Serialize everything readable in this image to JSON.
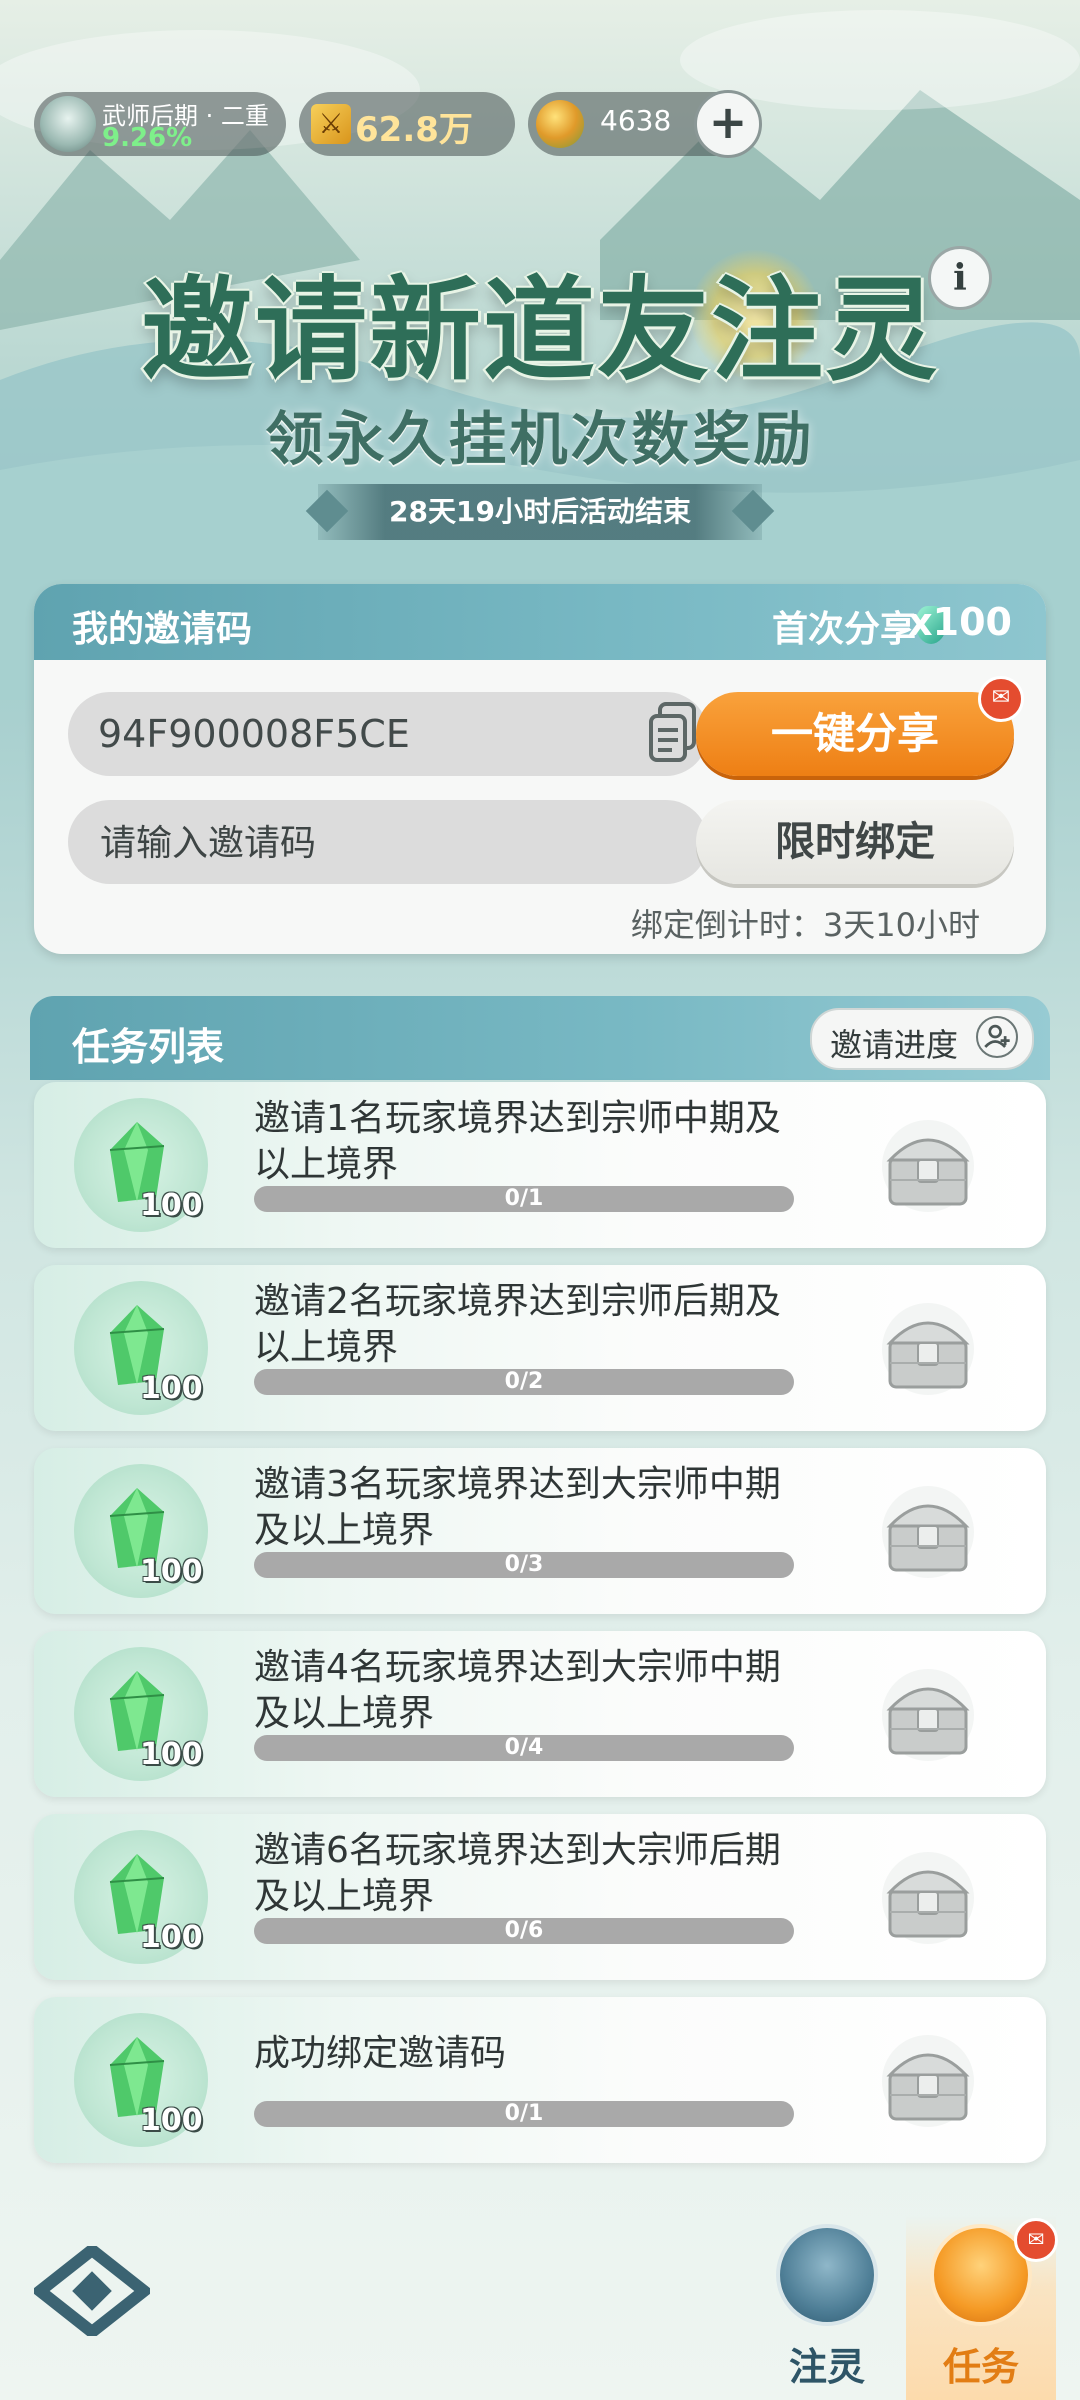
{
  "topbar": {
    "rank_name": "武师后期 · 二重",
    "rank_progress": "9.26%",
    "power": "62.8万",
    "currency": "4638",
    "add_symbol": "+"
  },
  "event": {
    "title": "邀请新道友注灵",
    "subtitle": "领永久挂机次数奖励",
    "countdown": "28天19小时后活动结束",
    "info_symbol": "i"
  },
  "invite": {
    "header": "我的邀请码",
    "first_share_label": "首次分享",
    "first_share_reward": "x100",
    "code": "94F900008F5CE",
    "share_button": "一键分享",
    "bind_placeholder": "请输入邀请码",
    "bind_button": "限时绑定",
    "bind_countdown": "绑定倒计时：3天10小时"
  },
  "tasks": {
    "header": "任务列表",
    "progress_button": "邀请进度",
    "items": [
      {
        "desc": "邀请1名玩家境界达到宗师中期及以上境界",
        "progress": "0/1",
        "reward": "100",
        "fill": 0
      },
      {
        "desc": "邀请2名玩家境界达到宗师后期及以上境界",
        "progress": "0/2",
        "reward": "100",
        "fill": 0
      },
      {
        "desc": "邀请3名玩家境界达到大宗师中期及以上境界",
        "progress": "0/3",
        "reward": "100",
        "fill": 0
      },
      {
        "desc": "邀请4名玩家境界达到大宗师中期及以上境界",
        "progress": "0/4",
        "reward": "100",
        "fill": 0
      },
      {
        "desc": "邀请6名玩家境界达到大宗师后期及以上境界",
        "progress": "0/6",
        "reward": "100",
        "fill": 0
      },
      {
        "desc": "成功绑定邀请码",
        "progress": "0/1",
        "reward": "100",
        "fill": 0
      }
    ]
  },
  "nav": {
    "lingzhu": "注灵",
    "task": "任务"
  },
  "colors": {
    "accent_orange": "#ee7f14",
    "header_teal": "#5fa3b0",
    "power_gold": "#ffe49a",
    "rank_green": "#7ef08a"
  },
  "icons": [
    "avatar-icon",
    "power-icon",
    "coin-icon",
    "plus-icon",
    "info-icon",
    "gem-icon",
    "copy-icon",
    "notification-badge-icon",
    "invite-progress-icon",
    "chest-icon",
    "game-logo-icon",
    "lingzhu-nav-icon",
    "task-nav-icon"
  ]
}
